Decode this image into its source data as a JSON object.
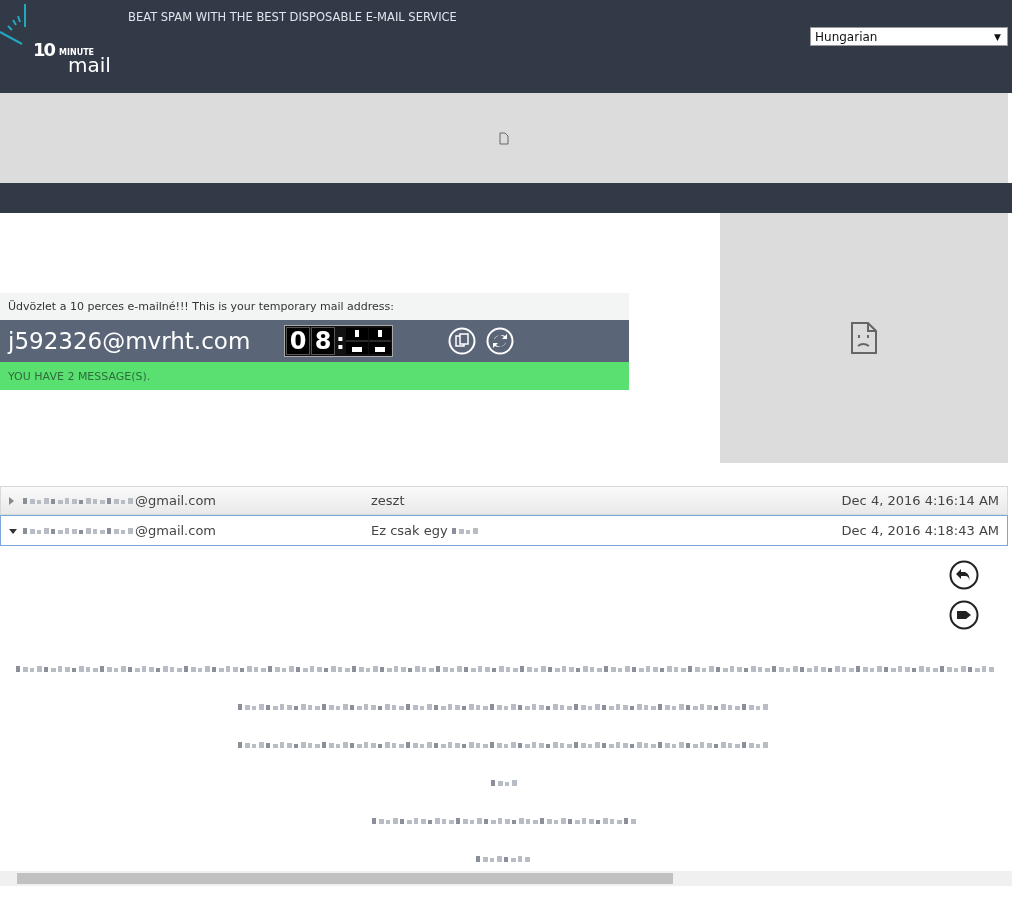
{
  "header": {
    "logo": {
      "number": "10",
      "word": "MINUTE",
      "name": "mail"
    },
    "tagline": "BEAT SPAM WITH THE BEST DISPOSABLE E-MAIL SERVICE",
    "language": {
      "value": "Hungarian",
      "caret": "▼"
    }
  },
  "mailbox": {
    "greeting": "Üdvözlet a 10 perces e-mailné!!! This is your temporary mail address:",
    "address": "j592326@mvrht.com",
    "timer": {
      "digits": [
        "0",
        "8"
      ],
      "separator": ":"
    },
    "status": "YOU HAVE 2 MESSAGE(S)."
  },
  "messages": [
    {
      "sender": "@gmail.com",
      "subject": "zeszt",
      "date": "Dec 4, 2016 4:16:14 AM",
      "expanded": false
    },
    {
      "sender": "@gmail.com",
      "subject": "Ez csak egy",
      "date": "Dec 4, 2016 4:18:43 AM",
      "expanded": true
    }
  ]
}
